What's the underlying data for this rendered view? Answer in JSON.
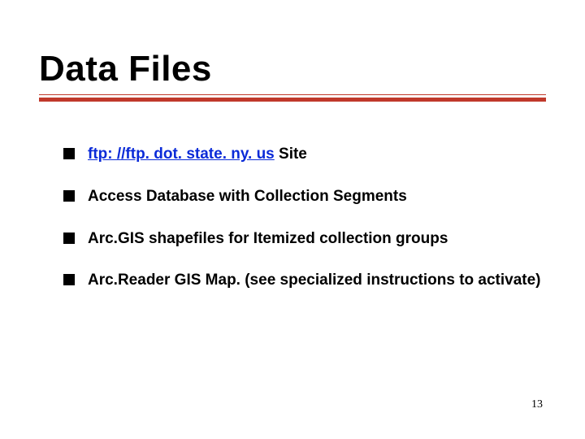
{
  "title": "Data Files",
  "bullets": [
    {
      "link_text": "ftp: //ftp. dot. state. ny. us",
      "link_href": "ftp://ftp.dot.state.ny.us",
      "suffix": "  Site"
    },
    {
      "text": "Access Database with Collection Segments"
    },
    {
      "text": "Arc.GIS shapefiles for Itemized collection groups"
    },
    {
      "text": "Arc.Reader GIS Map.  (see specialized instructions to activate)"
    }
  ],
  "page_number": "13",
  "accent_color": "#c0392b"
}
